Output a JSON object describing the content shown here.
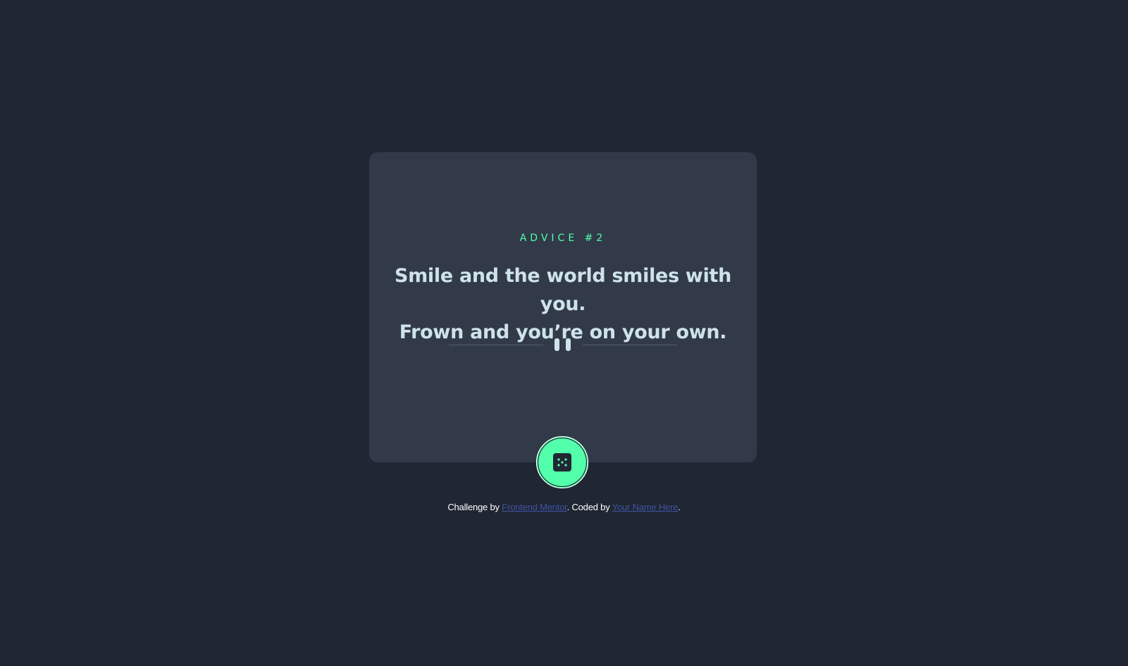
{
  "card": {
    "advice_label": "ADVICE #2",
    "advice_text_line1": "Smile and the world smiles with you.",
    "advice_text_line2": "Frown and you’re on your own."
  },
  "attribution": {
    "prefix": "Challenge by ",
    "link1_label": "Frontend Mentor",
    "middle": ". Coded by ",
    "link2_label": "Your Name Here",
    "suffix": "."
  },
  "icons": {
    "divider": "pause-quote-divider-icon",
    "dice": "dice-icon"
  },
  "colors": {
    "background": "#202632",
    "card": "#323a49",
    "accent": "#53ffaa",
    "text": "#cee3e9",
    "link": "#3e52a3"
  }
}
